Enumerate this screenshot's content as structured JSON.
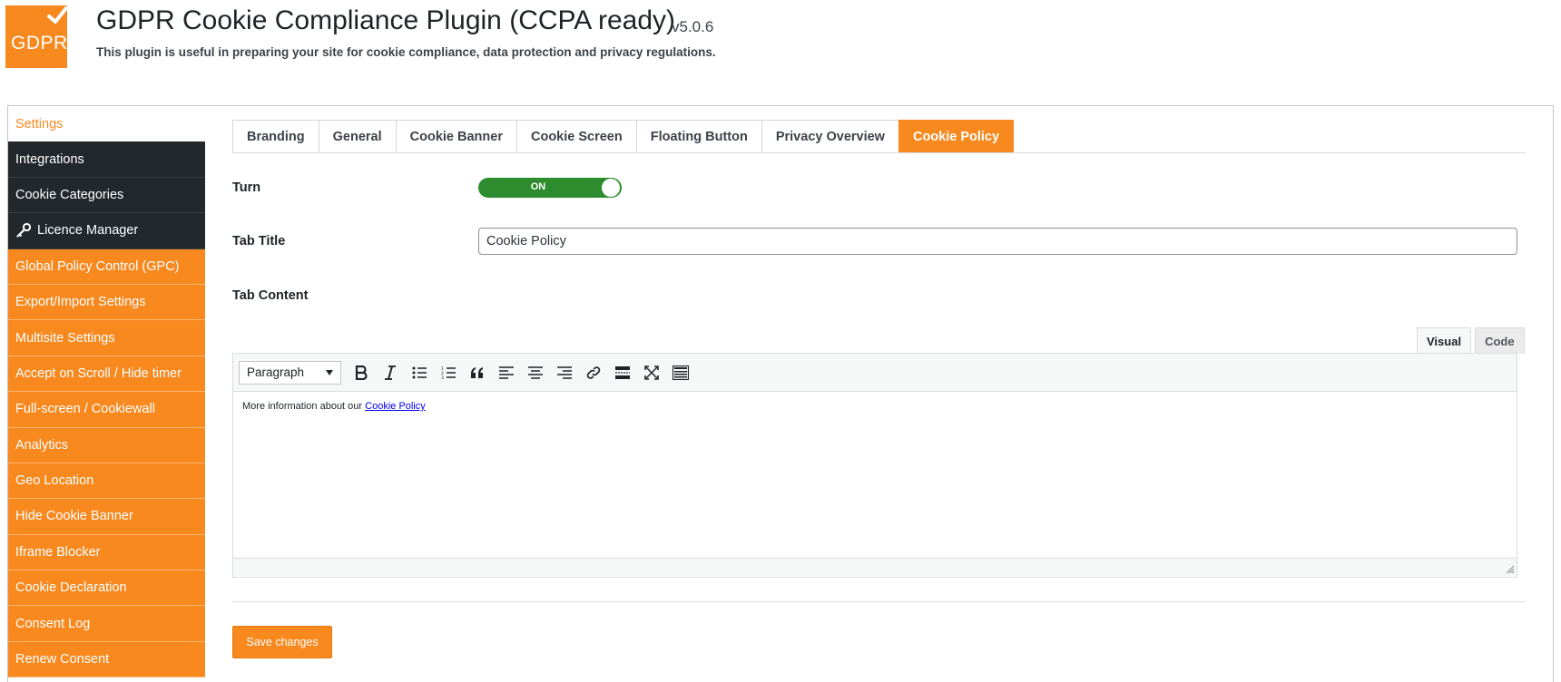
{
  "header": {
    "logo_text": "GDPR",
    "title": "GDPR Cookie Compliance Plugin (CCPA ready)",
    "version": "v5.0.6",
    "subtitle": "This plugin is useful in preparing your site for cookie compliance, data protection and privacy regulations."
  },
  "sidebar": {
    "items": [
      {
        "label": "Settings"
      },
      {
        "label": "Integrations"
      },
      {
        "label": "Cookie Categories"
      },
      {
        "label": "Licence Manager",
        "icon": "key-icon"
      },
      {
        "label": "Global Policy Control (GPC)"
      },
      {
        "label": "Export/Import Settings"
      },
      {
        "label": "Multisite Settings"
      },
      {
        "label": "Accept on Scroll / Hide timer"
      },
      {
        "label": "Full-screen / Cookiewall"
      },
      {
        "label": "Analytics"
      },
      {
        "label": "Geo Location"
      },
      {
        "label": "Hide Cookie Banner"
      },
      {
        "label": "Iframe Blocker"
      },
      {
        "label": "Cookie Declaration"
      },
      {
        "label": "Consent Log"
      },
      {
        "label": "Renew Consent"
      }
    ]
  },
  "tabs": [
    {
      "label": "Branding"
    },
    {
      "label": "General"
    },
    {
      "label": "Cookie Banner"
    },
    {
      "label": "Cookie Screen"
    },
    {
      "label": "Floating Button"
    },
    {
      "label": "Privacy Overview"
    },
    {
      "label": "Cookie Policy",
      "active": true
    }
  ],
  "form": {
    "turn_label": "Turn",
    "turn_state": "ON",
    "tab_title_label": "Tab Title",
    "tab_title_value": "Cookie Policy",
    "tab_content_label": "Tab Content"
  },
  "editor": {
    "visual_tab": "Visual",
    "code_tab": "Code",
    "format_select": "Paragraph",
    "content_prefix": "More information about our ",
    "content_link": "Cookie Policy"
  },
  "save_label": "Save changes",
  "colors": {
    "accent": "#f7891f",
    "sidebar_dark": "#23282d",
    "toggle_on": "#2d8c2e"
  }
}
